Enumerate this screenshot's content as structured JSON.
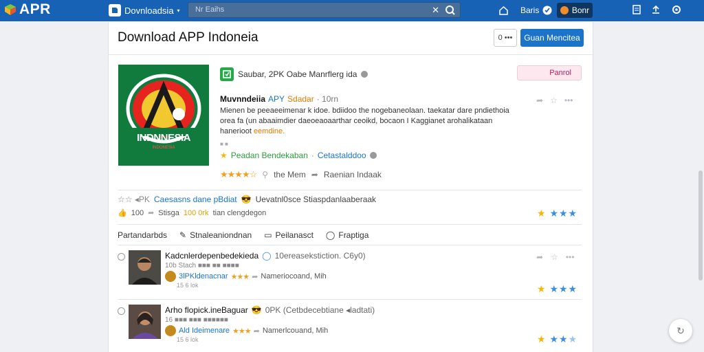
{
  "header": {
    "logo_text": "APR",
    "site_name": "Dovnloadsia",
    "search_placeholder": "Nr Eaihs",
    "nav_item_1": "Baris",
    "nav_button": "Bonr"
  },
  "page": {
    "title": "Download APP Indoneia",
    "dots_label": "0 •••",
    "primary_button": "Guan Mencitea"
  },
  "app": {
    "art_title": "INDNNESIA",
    "art_subtitle": "INDONESIA",
    "developer": "Saubar, 2PK Oabe Manrflerg ida",
    "follow_button": "Panrol",
    "name": "Muvnndeiia",
    "tag": "APY",
    "tag2": "Sdadar",
    "age": "· 10rn",
    "desc_1": "Mienen be peeaeeimenar k idoe. bdiidoo the nogebaneolaan. taekatar dare pndiethoia orea fa (un abaaimdier daeoeaoaarthar ceoikd, bocaon",
    "desc_2": "I Kaggianet arohalikataan",
    "desc_3": "hanerioot",
    "desc_highlight": "eemdine.",
    "small_mark": "■ ■",
    "category_a": "Peadan Bendekaban",
    "category_b": "Cetastalddoo",
    "rating_stars": "★★★★☆",
    "meta_1": "the Mem",
    "meta_2": "Raenian Indaak"
  },
  "stats": {
    "prefix": "☆☆ ◂PK",
    "blue_text": "Caesasns dane pBdiat",
    "rest": "Uevatnl0sce Stiaspdanlaaberaak",
    "line2_a": "100",
    "line2_b": "Stisga",
    "line2_orange": "100 0rk",
    "line2_c": "tian clengdegon"
  },
  "tabs": [
    {
      "label": "Partandarbds",
      "icon": ""
    },
    {
      "label": "Stnaleaniondnan",
      "icon": "✎"
    },
    {
      "label": "Peilanasct",
      "icon": "▭"
    },
    {
      "label": "Fraptiga",
      "icon": "◯"
    }
  ],
  "items": [
    {
      "title": "Kadcnlerdepenbedekieda",
      "meta": "10ereasekstiction. C6y0)",
      "sub": "10b Stach ■■■ ■■ ■■■■",
      "author": "3lPKldenacnar",
      "stars": "★★★",
      "author_meta": "Nameriocoand, Mih",
      "foot": "15 6 lok"
    },
    {
      "title": "Arho flopick.ineBaguar",
      "meta": "0PK (Cetbdecebtiane ◂ladtati)",
      "sub": "16 ■■■ ■■■ ■■■■■■",
      "author": "Ald Ideimenare",
      "stars": "★★★",
      "author_meta": "Namerlcouand, Mih",
      "foot": "15 6 lok"
    }
  ],
  "colors": {
    "topbar": "#1762b5",
    "accent": "#1b74c9",
    "app_art_bg": "#117a3d"
  }
}
